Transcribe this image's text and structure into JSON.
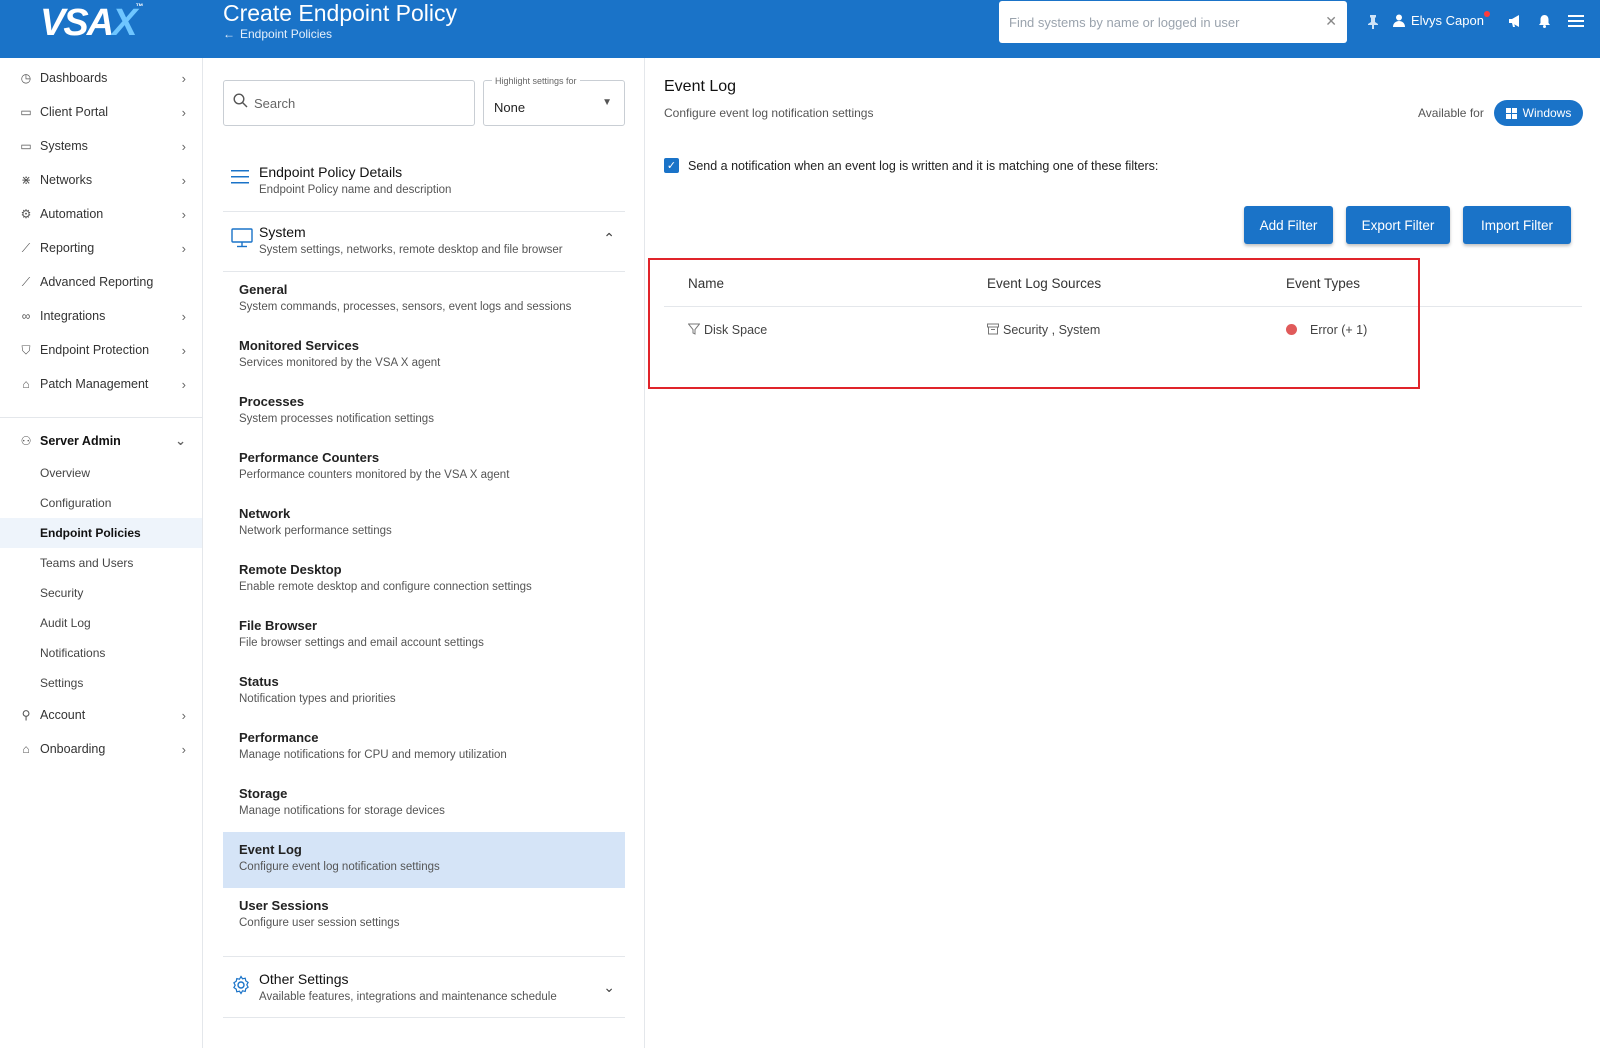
{
  "header": {
    "logo": "VSA",
    "logo_x": "X",
    "logo_tm": "™",
    "title": "Create Endpoint Policy",
    "back_link": "Endpoint Policies",
    "search_placeholder": "Find systems by name or logged in user",
    "user_name": "Elvys Capon"
  },
  "sidebar": {
    "items": [
      {
        "label": "Dashboards",
        "icon": "dashboard-icon"
      },
      {
        "label": "Client Portal",
        "icon": "window-icon"
      },
      {
        "label": "Systems",
        "icon": "monitor-icon"
      },
      {
        "label": "Networks",
        "icon": "network-icon"
      },
      {
        "label": "Automation",
        "icon": "automation-icon"
      },
      {
        "label": "Reporting",
        "icon": "chart-icon"
      },
      {
        "label": "Advanced Reporting",
        "icon": "chart-icon"
      },
      {
        "label": "Integrations",
        "icon": "infinity-icon"
      },
      {
        "label": "Endpoint Protection",
        "icon": "shield-icon"
      },
      {
        "label": "Patch Management",
        "icon": "patch-icon"
      }
    ],
    "server_admin": {
      "label": "Server Admin",
      "sub_items": [
        "Overview",
        "Configuration",
        "Endpoint Policies",
        "Teams and Users",
        "Security",
        "Audit Log",
        "Notifications",
        "Settings"
      ]
    },
    "bottom_items": [
      {
        "label": "Account",
        "icon": "user-icon"
      },
      {
        "label": "Onboarding",
        "icon": "graduation-icon"
      }
    ]
  },
  "middle": {
    "search_placeholder": "Search",
    "highlight_label": "Highlight settings for",
    "highlight_value": "None",
    "details": {
      "title": "Endpoint Policy Details",
      "desc": "Endpoint Policy name and description"
    },
    "system": {
      "title": "System",
      "desc": "System settings, networks, remote desktop and file browser"
    },
    "sub_sections": [
      {
        "title": "General",
        "desc": "System commands, processes, sensors, event logs and sessions"
      },
      {
        "title": "Monitored Services",
        "desc": "Services monitored by the VSA X agent"
      },
      {
        "title": "Processes",
        "desc": "System processes notification settings"
      },
      {
        "title": "Performance Counters",
        "desc": "Performance counters monitored by the VSA X agent"
      },
      {
        "title": "Network",
        "desc": "Network performance settings"
      },
      {
        "title": "Remote Desktop",
        "desc": "Enable remote desktop and configure connection settings"
      },
      {
        "title": "File Browser",
        "desc": "File browser settings and email account settings"
      },
      {
        "title": "Status",
        "desc": "Notification types and priorities"
      },
      {
        "title": "Performance",
        "desc": "Manage notifications for CPU and memory utilization"
      },
      {
        "title": "Storage",
        "desc": "Manage notifications for storage devices"
      },
      {
        "title": "Event Log",
        "desc": "Configure event log notification settings"
      },
      {
        "title": "User Sessions",
        "desc": "Configure user session settings"
      }
    ],
    "other": {
      "title": "Other Settings",
      "desc": "Available features, integrations and maintenance schedule"
    }
  },
  "content": {
    "title": "Event Log",
    "desc": "Configure event log notification settings",
    "available_for": "Available for",
    "platform": "Windows",
    "notify_text": "Send a notification when an event log is written and it is matching one of these filters:",
    "buttons": {
      "add": "Add Filter",
      "export": "Export Filter",
      "import": "Import Filter"
    },
    "table": {
      "headers": [
        "Name",
        "Event Log Sources",
        "Event Types"
      ],
      "rows": [
        {
          "name": "Disk Space",
          "sources": "Security , System",
          "types": "Error (+ 1)"
        }
      ]
    }
  },
  "colors": {
    "accent": "#1a73c8",
    "error": "#e05a5a",
    "highlight_border": "#e0242a"
  }
}
